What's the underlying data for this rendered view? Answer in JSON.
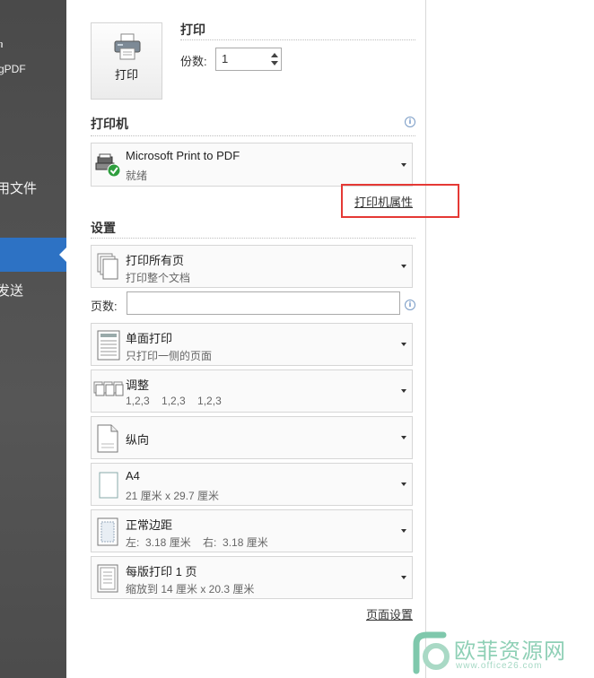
{
  "sidebar": {
    "items": [
      {
        "label": "ካ"
      },
      {
        "label": "gPDF"
      },
      {
        "label": "用文件"
      },
      {
        "label": ""
      },
      {
        "label": "发送"
      }
    ]
  },
  "print_section": {
    "title": "打印",
    "print_button_label": "打印",
    "copies_label": "份数:",
    "copies_value": "1"
  },
  "printer_section": {
    "title": "打印机",
    "printer_name": "Microsoft Print to PDF",
    "printer_status": "就绪",
    "properties_link": "打印机属性"
  },
  "settings_section": {
    "title": "设置",
    "pages_label": "页数:",
    "pages_value": "",
    "options": [
      {
        "title": "打印所有页",
        "subtitle": "打印整个文档"
      },
      {
        "title": "单面打印",
        "subtitle": "只打印一侧的页面"
      },
      {
        "title": "调整",
        "subtitle": "1,2,3    1,2,3    1,2,3"
      },
      {
        "title": "纵向",
        "subtitle": ""
      },
      {
        "title": "A4",
        "subtitle": "21 厘米 x 29.7 厘米"
      },
      {
        "title": "正常边距",
        "subtitle": "左:  3.18 厘米    右:  3.18 厘米"
      },
      {
        "title": "每版打印 1 页",
        "subtitle": "缩放到 14 厘米 x 20.3 厘米"
      }
    ],
    "page_setup_link": "页面设置"
  },
  "icons": {
    "info": "info-icon",
    "printer": "printer-icon",
    "ready_check": "check-icon"
  },
  "colors": {
    "sidebar_bg": "#4f4f4f",
    "sidebar_active": "#2d72c4",
    "highlight_border": "#e53935",
    "check_green": "#2e9e3e"
  },
  "watermark": {
    "text": "欧菲资源网",
    "url_text": "www.office26.com"
  }
}
